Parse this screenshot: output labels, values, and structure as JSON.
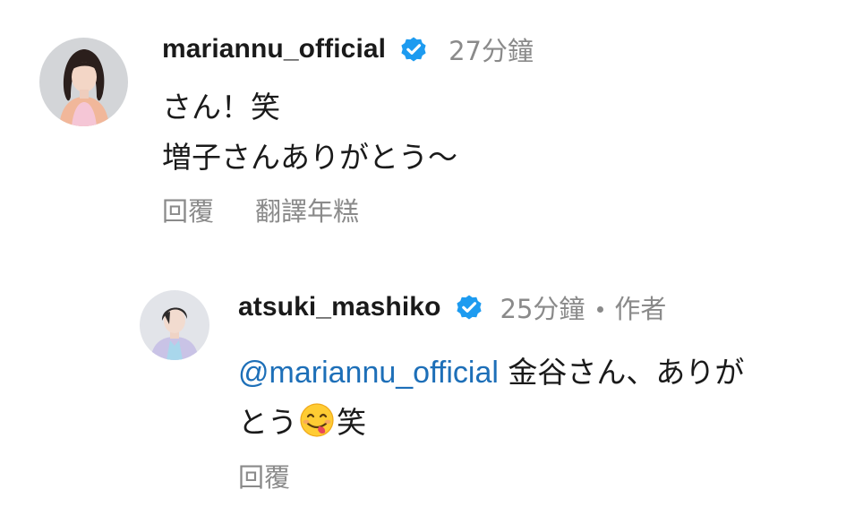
{
  "comments": [
    {
      "username": "mariannu_official",
      "verified": true,
      "time": "27分鐘",
      "lines": [
        "さん！笑",
        "増子さんありがとう〜"
      ],
      "actions": {
        "reply": "回覆",
        "translate": "翻譯年糕"
      }
    },
    {
      "username": "atsuki_mashiko",
      "verified": true,
      "time": "25分鐘",
      "author_label": "作者",
      "mention": "@mariannu_official",
      "text_line1": " 金谷さん、ありが",
      "text_line2_a": "とう",
      "emoji": "face-savoring-food-emoji",
      "text_line2_b": "笑",
      "actions": {
        "reply": "回覆"
      }
    }
  ],
  "colors": {
    "verified": "#1d9bf0",
    "mention": "#1d6fb8",
    "secondary_text": "#8a8a8a",
    "primary_text": "#1a1a1a"
  }
}
